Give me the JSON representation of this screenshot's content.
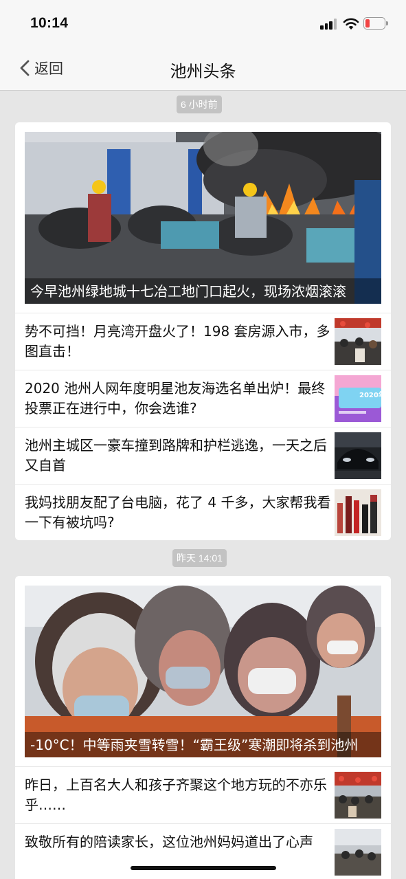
{
  "status_bar": {
    "time": "10:14"
  },
  "nav": {
    "back_label": "返回",
    "title": "池州头条"
  },
  "groups": [
    {
      "time_label": "6 小时前",
      "hero_caption": "今早池州绿地城十七冶工地门口起火，现场浓烟滚滚",
      "items": [
        {
          "title": "势不可挡！月亮湾开盘火了！198 套房源入市，多图直击！"
        },
        {
          "title": "2020 池州人网年度明星池友海选名单出炉！最终投票正在进行中，你会选谁?",
          "thumb_text": "2020年度明星池友"
        },
        {
          "title": "池州主城区一豪车撞到路牌和护栏逃逸，一天之后又自首"
        },
        {
          "title": "我妈找朋友配了台电脑，花了 4 千多，大家帮我看一下有被坑吗?"
        }
      ]
    },
    {
      "time_label": "昨天 14:01",
      "hero_caption": "-10°C！中等雨夹雪转雪！“霸王级”寒潮即将杀到池州",
      "items": [
        {
          "title": "昨日，上百名大人和孩子齐聚这个地方玩的不亦乐乎……"
        },
        {
          "title": "致敬所有的陪读家长，这位池州妈妈道出了心声"
        }
      ]
    }
  ]
}
